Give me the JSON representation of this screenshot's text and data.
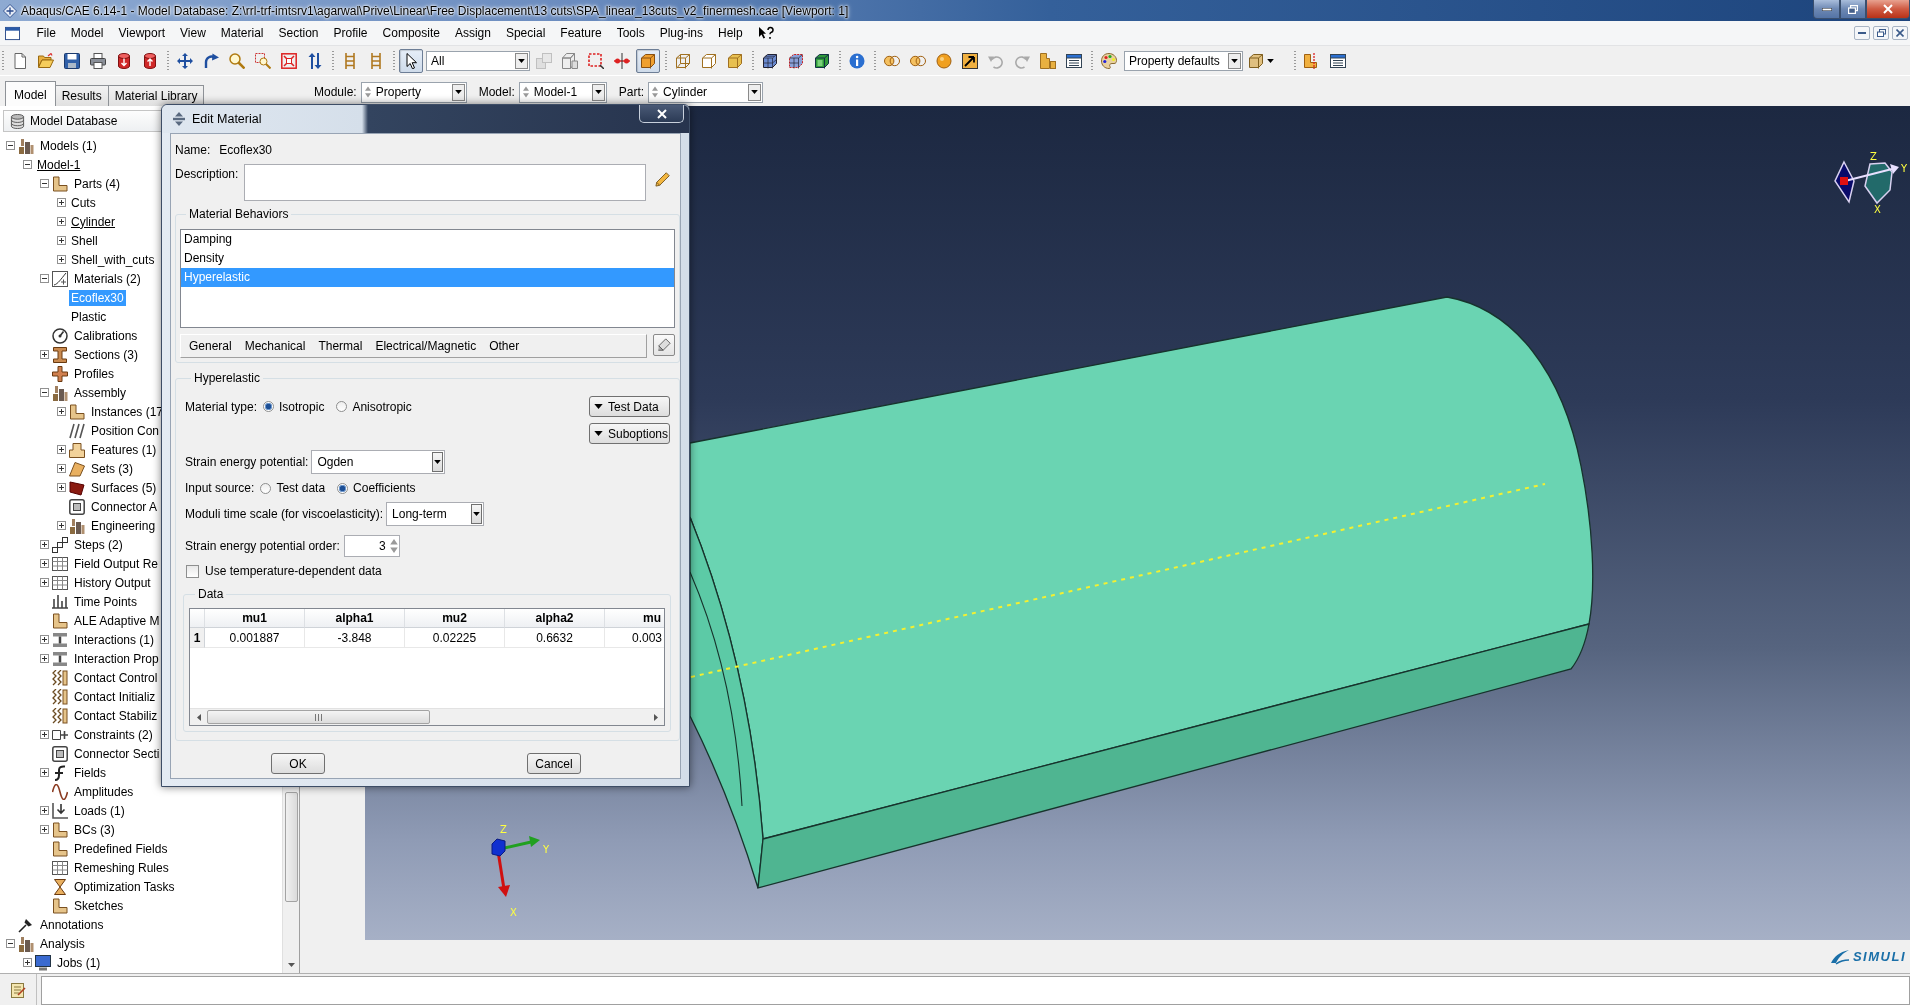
{
  "window": {
    "title": "Abaqus/CAE 6.14-1 - Model Database: Z:\\rrl-trf-imtsrv1\\agarwal\\Prive\\Linear\\Free Displacement\\13 cuts\\SPA_linear_13cuts_v2_finermesh.cae [Viewport: 1]"
  },
  "menu": [
    "File",
    "Model",
    "Viewport",
    "View",
    "Material",
    "Section",
    "Profile",
    "Composite",
    "Assign",
    "Special",
    "Feature",
    "Tools",
    "Plug-ins",
    "Help"
  ],
  "toolbar": [
    {
      "kind": "buttons",
      "items": [
        {
          "pressed": false,
          "disabled": false
        },
        {
          "pressed": false,
          "disabled": false
        },
        {
          "pressed": false,
          "disabled": false
        },
        {
          "pressed": false,
          "disabled": false
        },
        {
          "pressed": false,
          "disabled": false
        },
        {
          "pressed": false,
          "disabled": false
        }
      ]
    },
    {
      "kind": "buttons",
      "items": [
        {
          "pressed": false,
          "disabled": false
        },
        {
          "pressed": false,
          "disabled": false
        },
        {
          "pressed": false,
          "disabled": false
        },
        {
          "pressed": false,
          "disabled": false
        },
        {
          "pressed": false,
          "disabled": false
        },
        {
          "pressed": false,
          "disabled": false
        }
      ]
    },
    {
      "kind": "buttons",
      "items": [
        {
          "pressed": false,
          "disabled": false
        },
        {
          "pressed": false,
          "disabled": false
        }
      ]
    },
    {
      "kind": "buttons",
      "items": [
        {
          "pressed": true,
          "disabled": false
        }
      ]
    },
    {
      "kind": "combo",
      "value": "All"
    },
    {
      "kind": "buttons",
      "items": [
        {
          "pressed": false,
          "disabled": true
        },
        {
          "pressed": false,
          "disabled": false
        },
        {
          "pressed": false,
          "disabled": false
        },
        {
          "pressed": false,
          "disabled": false
        },
        {
          "pressed": true,
          "disabled": false
        }
      ]
    },
    {
      "kind": "buttons",
      "items": [
        {
          "pressed": false,
          "disabled": false
        },
        {
          "pressed": false,
          "disabled": false
        },
        {
          "pressed": false,
          "disabled": false
        }
      ]
    },
    {
      "kind": "buttons",
      "items": [
        {
          "pressed": false,
          "disabled": false
        },
        {
          "pressed": false,
          "disabled": false
        },
        {
          "pressed": false,
          "disabled": false
        }
      ]
    },
    {
      "kind": "buttons",
      "items": [
        {
          "pressed": false,
          "disabled": false
        }
      ]
    },
    {
      "kind": "buttons",
      "items": [
        {
          "pressed": false,
          "disabled": false
        },
        {
          "pressed": false,
          "disabled": false
        },
        {
          "pressed": false,
          "disabled": false
        },
        {
          "pressed": false,
          "disabled": false
        },
        {
          "pressed": false,
          "disabled": true
        },
        {
          "pressed": false,
          "disabled": true
        },
        {
          "pressed": false,
          "disabled": false
        },
        {
          "pressed": false,
          "disabled": false
        }
      ]
    },
    {
      "kind": "buttons",
      "items": [
        {
          "pressed": false,
          "disabled": false
        }
      ]
    },
    {
      "kind": "combo",
      "value": "Property defaults"
    },
    {
      "kind": "buttons",
      "items": [
        {
          "pressed": false,
          "disabled": false
        }
      ]
    },
    {
      "kind": "buttons",
      "items": [
        {
          "pressed": false,
          "disabled": false
        },
        {
          "pressed": false,
          "disabled": false
        }
      ]
    }
  ],
  "tabs": [
    {
      "label": "Model",
      "selected": true
    },
    {
      "label": "Results",
      "selected": false
    },
    {
      "label": "Material Library",
      "selected": false
    }
  ],
  "context": [
    {
      "label": "Module:",
      "value": "Property"
    },
    {
      "label": "Model:",
      "value": "Model-1"
    },
    {
      "label": "Part:",
      "value": "Cylinder"
    }
  ],
  "model_tree": {
    "title": "Model Database",
    "items": [
      {
        "label": "Models (1)",
        "expanded": true,
        "selected": false,
        "current": false,
        "children": [
          {
            "label": "Model-1",
            "expanded": true,
            "selected": false,
            "current": true,
            "children": [
              {
                "label": "Parts (4)",
                "expanded": true,
                "selected": false,
                "current": false,
                "children": [
                  {
                    "label": "Cuts",
                    "expanded": false,
                    "selected": false,
                    "current": false
                  },
                  {
                    "label": "Cylinder",
                    "expanded": false,
                    "selected": false,
                    "current": true
                  },
                  {
                    "label": "Shell",
                    "expanded": false,
                    "selected": false,
                    "current": false
                  },
                  {
                    "label": "Shell_with_cuts",
                    "expanded": false,
                    "selected": false,
                    "current": false
                  }
                ]
              },
              {
                "label": "Materials (2)",
                "expanded": true,
                "selected": false,
                "current": false,
                "children": [
                  {
                    "label": "Ecoflex30",
                    "selected": true,
                    "current": false
                  },
                  {
                    "label": "Plastic",
                    "selected": false,
                    "current": false
                  }
                ]
              },
              {
                "label": "Calibrations",
                "selected": false,
                "current": false
              },
              {
                "label": "Sections (3)",
                "expanded": false,
                "selected": false,
                "current": false
              },
              {
                "label": "Profiles",
                "selected": false,
                "current": false
              },
              {
                "label": "Assembly",
                "expanded": true,
                "selected": false,
                "current": false,
                "children": [
                  {
                    "label": "Instances (17",
                    "expanded": false,
                    "selected": false,
                    "current": false
                  },
                  {
                    "label": "Position Con",
                    "selected": false,
                    "current": false
                  },
                  {
                    "label": "Features (1)",
                    "expanded": false,
                    "selected": false,
                    "current": false
                  },
                  {
                    "label": "Sets (3)",
                    "expanded": false,
                    "selected": false,
                    "current": false
                  },
                  {
                    "label": "Surfaces (5)",
                    "expanded": false,
                    "selected": false,
                    "current": false
                  },
                  {
                    "label": "Connector A",
                    "selected": false,
                    "current": false
                  },
                  {
                    "label": "Engineering",
                    "expanded": false,
                    "selected": false,
                    "current": false
                  }
                ]
              },
              {
                "label": "Steps (2)",
                "expanded": false,
                "selected": false,
                "current": false
              },
              {
                "label": "Field Output Re",
                "expanded": false,
                "selected": false,
                "current": false
              },
              {
                "label": "History Output",
                "expanded": false,
                "selected": false,
                "current": false
              },
              {
                "label": "Time Points",
                "selected": false,
                "current": false
              },
              {
                "label": "ALE Adaptive M",
                "selected": false,
                "current": false
              },
              {
                "label": "Interactions (1)",
                "expanded": false,
                "selected": false,
                "current": false
              },
              {
                "label": "Interaction Prop",
                "expanded": false,
                "selected": false,
                "current": false
              },
              {
                "label": "Contact Control",
                "selected": false,
                "current": false
              },
              {
                "label": "Contact Initializ",
                "selected": false,
                "current": false
              },
              {
                "label": "Contact Stabiliz",
                "selected": false,
                "current": false
              },
              {
                "label": "Constraints (2)",
                "expanded": false,
                "selected": false,
                "current": false
              },
              {
                "label": "Connector Secti",
                "selected": false,
                "current": false
              },
              {
                "label": "Fields",
                "expanded": false,
                "selected": false,
                "current": false
              },
              {
                "label": "Amplitudes",
                "selected": false,
                "current": false
              },
              {
                "label": "Loads (1)",
                "expanded": false,
                "selected": false,
                "current": false
              },
              {
                "label": "BCs (3)",
                "expanded": false,
                "selected": false,
                "current": false
              },
              {
                "label": "Predefined Fields",
                "selected": false,
                "current": false
              },
              {
                "label": "Remeshing Rules",
                "selected": false,
                "current": false
              },
              {
                "label": "Optimization Tasks",
                "selected": false,
                "current": false
              },
              {
                "label": "Sketches",
                "selected": false,
                "current": false
              }
            ]
          }
        ]
      },
      {
        "label": "Annotations",
        "selected": false,
        "current": false
      },
      {
        "label": "Analysis",
        "expanded": true,
        "selected": false,
        "current": false,
        "children": [
          {
            "label": "Jobs (1)",
            "expanded": false,
            "selected": false,
            "current": false
          }
        ]
      }
    ]
  },
  "viewport": {
    "view_compass": {
      "z": "Z",
      "y": "Y",
      "x": "X"
    },
    "axis_triad": {
      "z": "Z",
      "y": "Y",
      "x": "X"
    }
  },
  "brand": "SIMULI",
  "dialog": {
    "title": "Edit Material",
    "name_label": "Name:",
    "name": "Ecoflex30",
    "description_label": "Description:",
    "behaviors": {
      "title": "Material Behaviors",
      "items": [
        {
          "label": "Damping",
          "selected": false
        },
        {
          "label": "Density",
          "selected": false
        },
        {
          "label": "Hyperelastic",
          "selected": true
        }
      ],
      "categories": [
        "General",
        "Mechanical",
        "Thermal",
        "Electrical/Magnetic",
        "Other"
      ]
    },
    "section": {
      "title": "Hyperelastic",
      "material_type": {
        "label": "Material type:",
        "options": [
          {
            "label": "Isotropic",
            "selected": true
          },
          {
            "label": "Anisotropic",
            "selected": false
          }
        ]
      },
      "buttons": [
        "Test Data",
        "Suboptions"
      ],
      "strain_energy_potential": {
        "label": "Strain energy potential:",
        "value": "Ogden"
      },
      "input_source": {
        "label": "Input source:",
        "options": [
          {
            "label": "Test data",
            "selected": false
          },
          {
            "label": "Coefficients",
            "selected": true
          }
        ]
      },
      "moduli_time_scale": {
        "label": "Moduli time scale (for viscoelasticity):",
        "value": "Long-term"
      },
      "potential_order": {
        "label": "Strain energy potential order:",
        "value": "3"
      },
      "temperature_dependent": {
        "label": "Use temperature-dependent data",
        "checked": false
      },
      "data": {
        "title": "Data",
        "columns": [
          "mu1",
          "alpha1",
          "mu2",
          "alpha2",
          "mu"
        ],
        "rows": [
          {
            "number": "1",
            "cells": [
              "0.001887",
              "-3.848",
              "0.02225",
              "0.6632",
              "0.003"
            ]
          }
        ]
      }
    },
    "buttons": [
      "OK",
      "Cancel"
    ]
  }
}
